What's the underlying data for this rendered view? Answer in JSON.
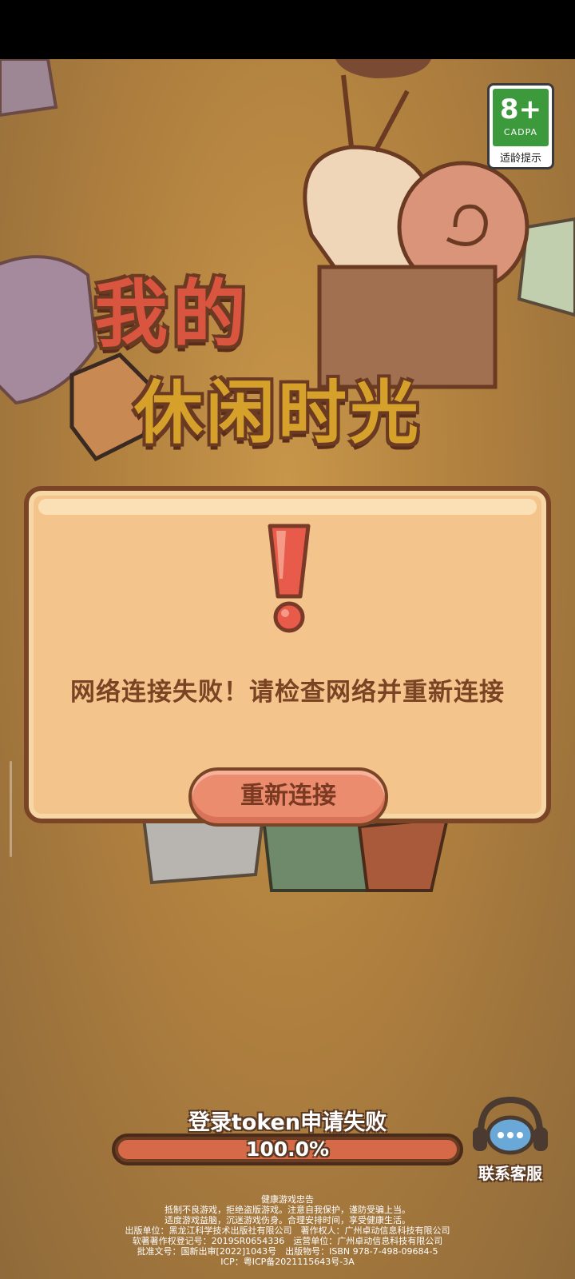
{
  "game": {
    "logo_line1": "我的",
    "logo_line2": "休闲时光"
  },
  "age_rating": {
    "age": "8+",
    "org": "CADPA",
    "tip": "适龄提示"
  },
  "dialog": {
    "message": "网络连接失败！请检查网络并重新连接",
    "button_label": "重新连接"
  },
  "loading": {
    "status": "登录token申请失败",
    "progress_text": "100.0%",
    "progress_value": 1.0
  },
  "customer_service": {
    "label": "联系客服"
  },
  "legal": {
    "lines": [
      "健康游戏忠告",
      "抵制不良游戏，拒绝盗版游戏。注意自我保护，谨防受骗上当。",
      "适度游戏益脑，沉迷游戏伤身。合理安排时间，享受健康生活。",
      "出版单位：黑龙江科学技术出版社有限公司　著作权人：广州卓动信息科技有限公司",
      "软著著作权登记号：2019SR0654336　运营单位：广州卓动信息科技有限公司",
      "批准文号：国新出审[2022]1043号　出版物号：ISBN 978-7-498-09684-5",
      "ICP：粤ICP备2021115643号-3A"
    ]
  },
  "colors": {
    "background": "#b0803f",
    "dialog_fill": "#f3c58c",
    "dialog_border": "#7a4526",
    "button_fill": "#ec8c6f",
    "progress_fill": "#d66a48",
    "age_green": "#3c9a3c"
  }
}
